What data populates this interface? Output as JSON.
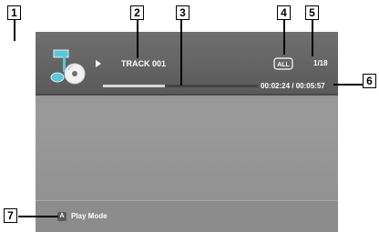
{
  "callouts": [
    "1",
    "2",
    "3",
    "4",
    "5",
    "6",
    "7"
  ],
  "header": {
    "icon": "music-disc-icon",
    "play_icon": "play-icon",
    "track_label": "TRACK 001",
    "repeat_icon": "repeat-all-icon",
    "repeat_label": "ALL",
    "track_count": "1/18",
    "time_display": "00:02:24 / 00:05:57",
    "progress_fraction": 0.4
  },
  "footer": {
    "key_label": "A",
    "label": "Play Mode"
  }
}
